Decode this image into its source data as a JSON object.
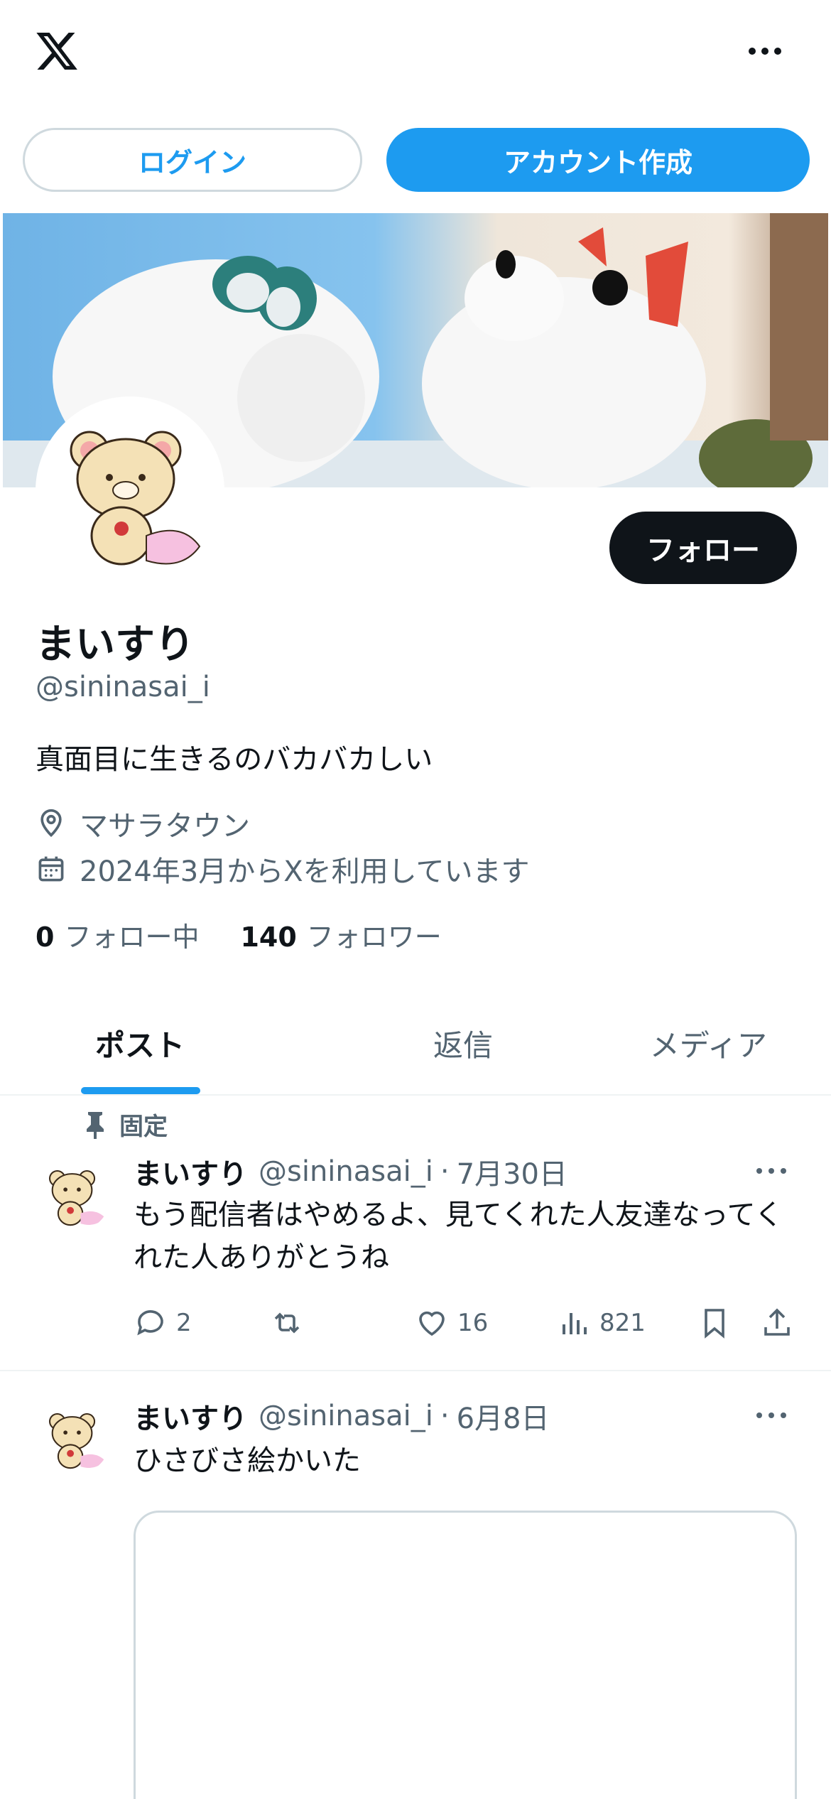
{
  "header": {
    "logo_icon": "x-logo-icon",
    "more_icon": "more-horizontal-icon"
  },
  "auth": {
    "login_label": "ログイン",
    "signup_label": "アカウント作成"
  },
  "profile": {
    "display_name": "まいすり",
    "handle": "@sininasai_i",
    "bio": "真面目に生きるのバカバカしい",
    "location": "マサラタウン",
    "joined": "2024年3月からXを利用しています",
    "following_count": "0",
    "following_label": "フォロー中",
    "followers_count": "140",
    "followers_label": "フォロワー",
    "follow_button": "フォロー"
  },
  "tabs": [
    {
      "label": "ポスト",
      "active": true
    },
    {
      "label": "返信",
      "active": false
    },
    {
      "label": "メディア",
      "active": false
    }
  ],
  "posts": [
    {
      "pinned_label": "固定",
      "name": "まいすり",
      "handle": "@sininasai_i",
      "separator": "·",
      "date": "7月30日",
      "text": "もう配信者はやめるよ、見てくれた人友達なってくれた人ありがとうね",
      "replies": "2",
      "reposts": "",
      "likes": "16",
      "views": "821"
    },
    {
      "name": "まいすり",
      "handle": "@sininasai_i",
      "separator": "·",
      "date": "6月8日",
      "text": "ひさびさ絵かいた"
    }
  ],
  "colors": {
    "accent": "#1d9bf0",
    "text": "#0f1419",
    "muted": "#536471",
    "border": "#cfd9de"
  }
}
